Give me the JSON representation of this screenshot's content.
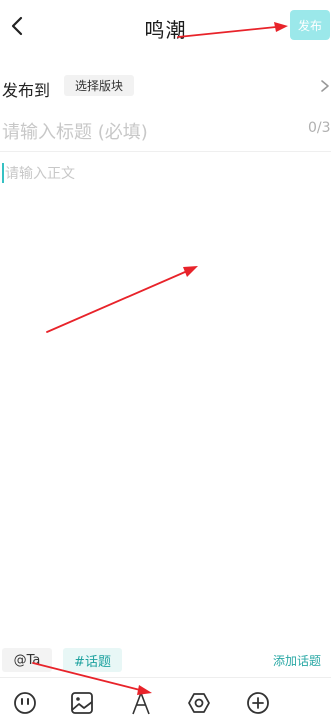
{
  "header": {
    "title": "鸣潮",
    "publish_label": "发布"
  },
  "target": {
    "label": "发布到",
    "board_button": "选择版块"
  },
  "editor": {
    "title_placeholder": "请输入标题 (必填)",
    "title_counter": "0/3",
    "body_placeholder": "请输入正文"
  },
  "tags": {
    "at_label": "@Ta",
    "topic_label": "#话题",
    "add_topic_label": "添加话题"
  },
  "toolbar": {
    "icons": [
      "emoji-icon",
      "image-icon",
      "text-style-icon",
      "settings-icon",
      "add-icon"
    ]
  },
  "colors": {
    "accent": "#36c1c3",
    "publish_bg": "#9be8ea",
    "topic_text": "#1fa3a0",
    "annotation": "#e8232a"
  }
}
